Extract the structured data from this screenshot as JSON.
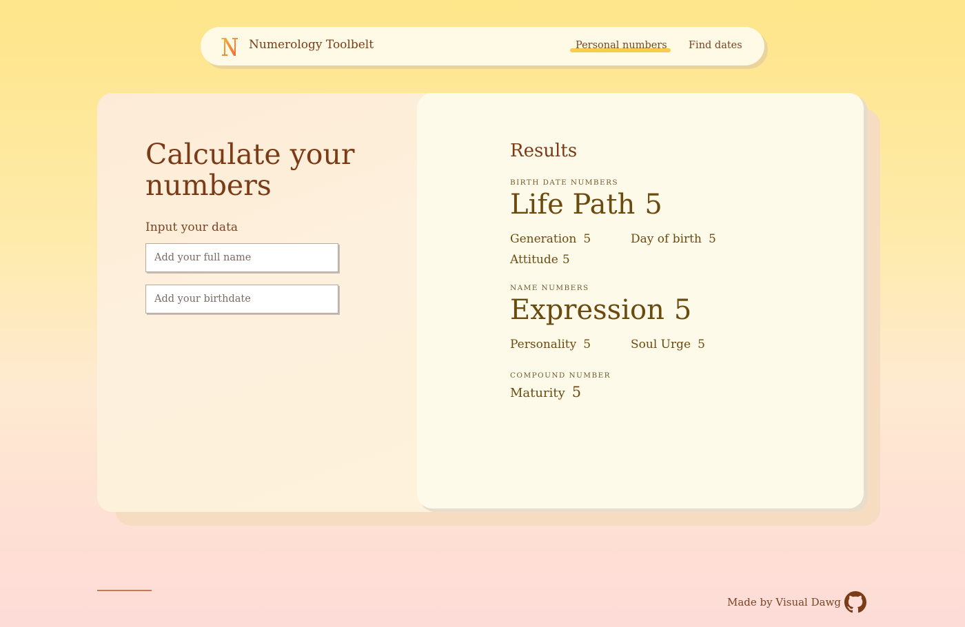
{
  "app": {
    "title": "Numerology Toolbelt",
    "logo_letter": "N",
    "logo_icon": "numerology-logo-icon"
  },
  "nav": {
    "items": [
      {
        "label": "Personal numbers",
        "active": true
      },
      {
        "label": "Find dates",
        "active": false
      }
    ]
  },
  "form": {
    "title": "Calculate your numbers",
    "label": "Input your data",
    "name_placeholder": "Add your full name",
    "name_value": "",
    "birthdate_placeholder": "Add your birthdate",
    "birthdate_value": ""
  },
  "results": {
    "title": "Results",
    "birth_section": "BIRTH DATE NUMBERS",
    "life_path": {
      "label": "Life Path",
      "value": "5"
    },
    "generation": {
      "label": "Generation",
      "value": "5"
    },
    "day_of_birth": {
      "label": "Day of birth",
      "value": "5"
    },
    "attitude": {
      "label": "Attitude",
      "value": "5"
    },
    "name_section": "NAME NUMBERS",
    "expression": {
      "label": "Expression",
      "value": "5"
    },
    "personality": {
      "label": "Personality",
      "value": "5"
    },
    "soul_urge": {
      "label": "Soul Urge",
      "value": "5"
    },
    "compound_section": "COMPOUND NUMBER",
    "maturity": {
      "label": "Maturity",
      "value": "5"
    }
  },
  "footer": {
    "made_by": "Made by Visual Dawg",
    "github_icon": "github-icon"
  },
  "colors": {
    "accent": "#f8cd4f",
    "text_brown": "#7a3b16",
    "results_text": "#6b4a10",
    "panel_bg": "#fefae9"
  }
}
